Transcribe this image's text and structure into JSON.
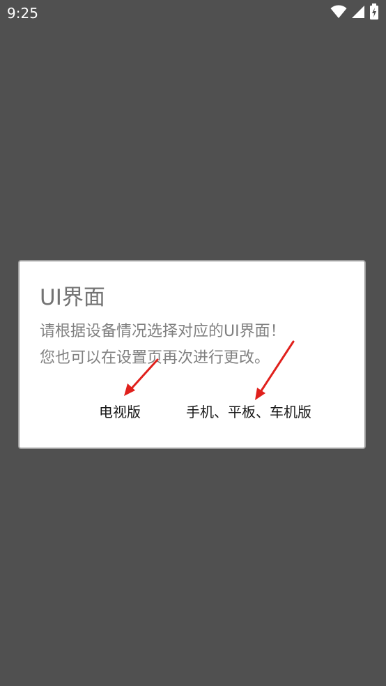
{
  "status_bar": {
    "time": "9:25",
    "icons": [
      "wifi-icon",
      "cell-signal-icon",
      "battery-charging-icon"
    ]
  },
  "dialog": {
    "title": "UI界面",
    "message_line1": "请根据设备情况选择对应的UI界面！",
    "message_line2": "您也可以在设置页再次进行更改。",
    "buttons": {
      "tv_label": "电视版",
      "mobile_label": "手机、平板、车机版"
    }
  },
  "colors": {
    "backdrop": "#505050",
    "dialog_bg": "#ffffff",
    "title_text": "#737373",
    "message_text": "#808080",
    "button_text": "#1a1a1a",
    "annotation_arrow": "#e0201c"
  }
}
